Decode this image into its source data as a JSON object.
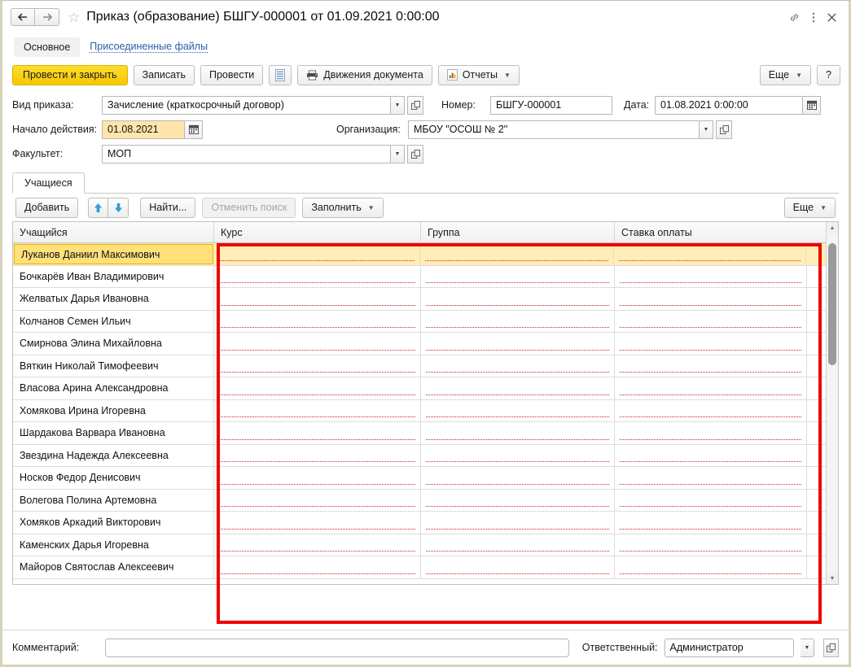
{
  "window": {
    "title": "Приказ (образование) БШГУ-000001 от 01.09.2021 0:00:00",
    "back_icon": "arrow-left-icon",
    "forward_icon": "arrow-right-icon",
    "favorite_icon": "star-icon",
    "link_icon": "link-icon",
    "menu_icon": "kebab-menu-icon",
    "close_icon": "close-icon"
  },
  "section_bar": {
    "main_tab": "Основное",
    "attached_files_link": "Присоединенные файлы"
  },
  "command_bar": {
    "post_and_close": "Провести и закрыть",
    "save": "Записать",
    "post": "Провести",
    "print_form_icon": "document-list-icon",
    "document_movements": "Движения документа",
    "document_movements_icon": "printer-icon",
    "reports": "Отчеты",
    "reports_icon": "chart-report-icon",
    "more": "Еще",
    "help": "?"
  },
  "form": {
    "order_type_label": "Вид приказа:",
    "order_type_value": "Зачисление (краткосрочный договор)",
    "number_label": "Номер:",
    "number_value": "БШГУ-000001",
    "date_label": "Дата:",
    "date_value": "01.08.2021  0:00:00",
    "start_label": "Начало действия:",
    "start_value": "01.08.2021",
    "organization_label": "Организация:",
    "organization_value": "МБОУ \"ОСОШ № 2\"",
    "faculty_label": "Факультет:",
    "faculty_value": "МОП",
    "dropdown_icon": "chevron-down-icon",
    "open_icon": "open-external-icon",
    "calendar_icon": "calendar-icon"
  },
  "table_section": {
    "tab_label": "Учащиеся",
    "toolbar": {
      "add": "Добавить",
      "move_up_icon": "arrow-up-icon",
      "move_down_icon": "arrow-down-icon",
      "find": "Найти...",
      "cancel_search": "Отменить поиск",
      "cancel_search_disabled": true,
      "fill": "Заполнить",
      "more": "Еще"
    },
    "columns": [
      "Учащийся",
      "Курс",
      "Группа",
      "Ставка оплаты"
    ],
    "rows": [
      {
        "name": "Луканов Даниил Максимович",
        "course": "",
        "group": "",
        "rate": "",
        "selected": true
      },
      {
        "name": "Бочкарёв Иван Владимирович",
        "course": "",
        "group": "",
        "rate": "",
        "selected": false
      },
      {
        "name": "Желватых Дарья Ивановна",
        "course": "",
        "group": "",
        "rate": "",
        "selected": false
      },
      {
        "name": "Колчанов Семен Ильич",
        "course": "",
        "group": "",
        "rate": "",
        "selected": false
      },
      {
        "name": "Смирнова Элина Михайловна",
        "course": "",
        "group": "",
        "rate": "",
        "selected": false
      },
      {
        "name": "Вяткин Николай Тимофеевич",
        "course": "",
        "group": "",
        "rate": "",
        "selected": false
      },
      {
        "name": "Власова Арина Александровна",
        "course": "",
        "group": "",
        "rate": "",
        "selected": false
      },
      {
        "name": "Хомякова Ирина Игоревна",
        "course": "",
        "group": "",
        "rate": "",
        "selected": false
      },
      {
        "name": "Шардакова Варвара Ивановна",
        "course": "",
        "group": "",
        "rate": "",
        "selected": false
      },
      {
        "name": "Звездина Надежда Алексеевна",
        "course": "",
        "group": "",
        "rate": "",
        "selected": false
      },
      {
        "name": "Носков Федор Денисович",
        "course": "",
        "group": "",
        "rate": "",
        "selected": false
      },
      {
        "name": "Волегова Полина Артемовна",
        "course": "",
        "group": "",
        "rate": "",
        "selected": false
      },
      {
        "name": "Хомяков Аркадий Викторович",
        "course": "",
        "group": "",
        "rate": "",
        "selected": false
      },
      {
        "name": "Каменских Дарья Игоревна",
        "course": "",
        "group": "",
        "rate": "",
        "selected": false
      },
      {
        "name": "Майоров Святослав Алексеевич",
        "course": "",
        "group": "",
        "rate": "",
        "selected": false
      }
    ],
    "scrollbar": {
      "up_icon": "scroll-up-icon",
      "down_icon": "scroll-down-icon"
    }
  },
  "footer": {
    "comment_label": "Комментарий:",
    "comment_value": "",
    "responsible_label": "Ответственный:",
    "responsible_value": "Администратор"
  },
  "annotation": {
    "highlight_color": "#f00000",
    "description": "red rectangle around Курс / Группа / Ставка оплаты columns"
  },
  "colors": {
    "primary_button": "#f5c900",
    "selected_row": "#ffe07a",
    "required_underline": "#cf2222",
    "link": "#2b5fa8"
  }
}
